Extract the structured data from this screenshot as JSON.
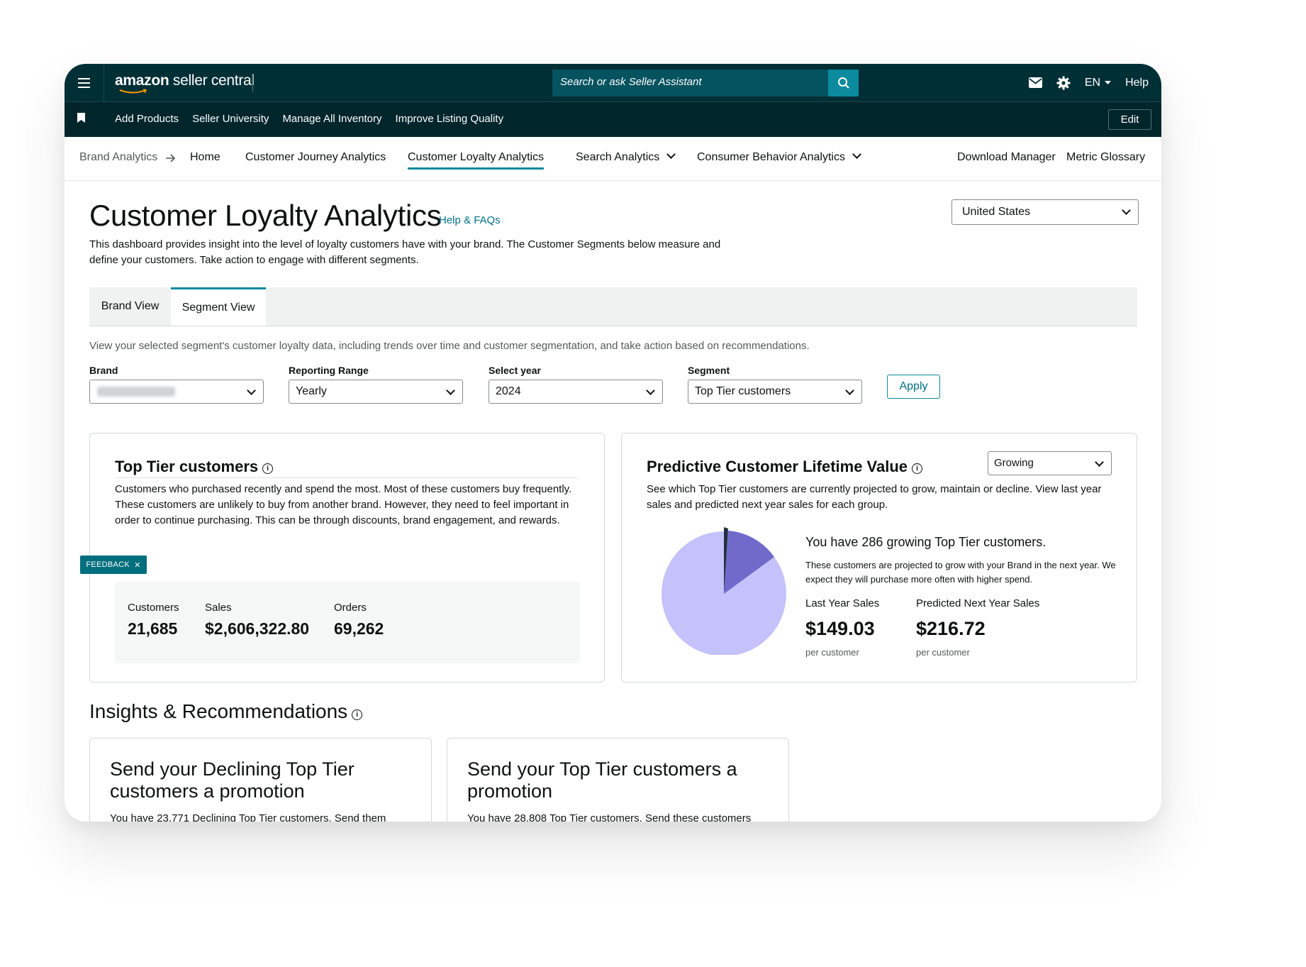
{
  "topbar": {
    "logo_main": "amazon",
    "logo_sub": " seller central",
    "search_placeholder": "Search or ask Seller Assistant",
    "language": "EN",
    "help": "Help"
  },
  "subbar": {
    "links": [
      "Add Products",
      "Seller University",
      "Manage All Inventory",
      "Improve Listing Quality"
    ],
    "edit_label": "Edit"
  },
  "crumbs": {
    "root": "Brand Analytics",
    "items": [
      "Home",
      "Customer Journey Analytics",
      "Customer Loyalty Analytics",
      "Search Analytics",
      "Consumer Behavior Analytics"
    ],
    "active": "Customer Loyalty Analytics",
    "right_links": [
      "Download Manager",
      "Metric Glossary"
    ]
  },
  "header": {
    "title": "Customer Loyalty Analytics",
    "help_link": "Help & FAQs",
    "description": "This dashboard provides insight into the level of loyalty customers have with your brand. The Customer Segments below measure and define your customers. Take action to engage with different segments.",
    "country": "United States"
  },
  "tabs": {
    "items": [
      "Brand View",
      "Segment View"
    ],
    "active": "Segment View",
    "hint": "View your selected segment's customer loyalty data, including trends over time and customer segmentation, and take action based on recommendations."
  },
  "filters": {
    "brand_label": "Brand",
    "range_label": "Reporting Range",
    "range_value": "Yearly",
    "year_label": "Select year",
    "year_value": "2024",
    "segment_label": "Segment",
    "segment_value": "Top Tier customers",
    "apply_label": "Apply"
  },
  "segment_card": {
    "title": "Top Tier customers",
    "description": "Customers who purchased recently and spend the most. Most of these customers buy frequently. These customers are unlikely to buy from another brand. However, they need to feel important in order to continue purchasing. This can be through discounts, brand engagement, and rewards.",
    "stats": [
      {
        "label": "Customers",
        "value": "21,685"
      },
      {
        "label": "Sales",
        "value": "$2,606,322.80"
      },
      {
        "label": "Orders",
        "value": "69,262"
      }
    ],
    "feedback_label": "FEEDBACK"
  },
  "pclv_card": {
    "title": "Predictive Customer Lifetime Value",
    "dropdown_value": "Growing",
    "description": "See which Top Tier customers are currently projected to grow, maintain or decline. View last year sales and predicted next year sales for each group.",
    "growing_headline": "You have 286 growing Top Tier customers.",
    "growing_sub": "These customers are projected to grow with your Brand in the next year. We expect they will purchase more often with higher spend.",
    "last_year_label": "Last Year Sales",
    "last_year_value": "$149.03",
    "next_year_label": "Predicted Next Year Sales",
    "next_year_value": "$216.72",
    "unit": "per customer",
    "pie_colors": {
      "main": "#c5c1fb",
      "highlight": "#716acb",
      "sliver": "#232f3e"
    }
  },
  "insights": {
    "title": "Insights & Recommendations",
    "cards": [
      {
        "title": "Send your Declining Top Tier customers a promotion",
        "text": "You have 23,771 Declining Top Tier customers. Send them"
      },
      {
        "title": "Send your Top Tier customers a promotion",
        "text": "You have 28,808 Top Tier customers. Send these customers"
      }
    ]
  }
}
